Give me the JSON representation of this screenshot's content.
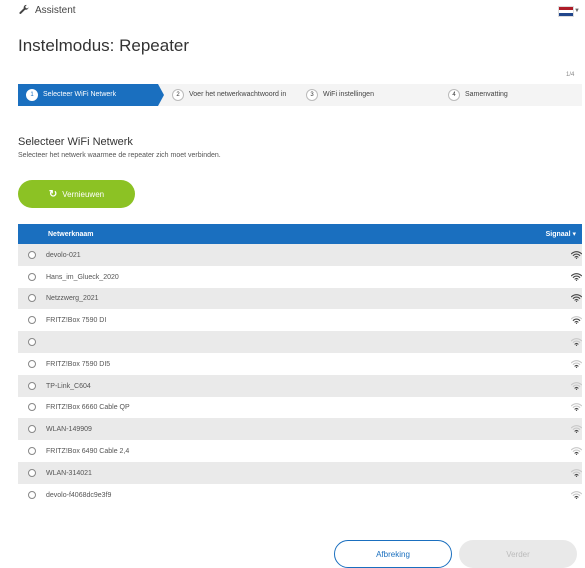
{
  "header": {
    "assistant_label": "Assistent",
    "wrench_icon": "wrench-icon",
    "language_flag": "flag-nl-icon"
  },
  "title": "Instelmodus: Repeater",
  "step_counter": "1/4",
  "steps": [
    {
      "num": "1",
      "label": "Selecteer WiFi Netwerk",
      "active": true
    },
    {
      "num": "2",
      "label": "Voer het netwerkwachtwoord in",
      "active": false
    },
    {
      "num": "3",
      "label": "WiFi instellingen",
      "active": false
    },
    {
      "num": "4",
      "label": "Samenvatting",
      "active": false
    }
  ],
  "section": {
    "title": "Selecteer WiFi Netwerk",
    "subtitle": "Selecteer het netwerk waarmee de repeater zich moet verbinden."
  },
  "refresh_button": {
    "label": "Vernieuwen",
    "icon": "refresh-icon"
  },
  "table": {
    "col_name": "Netwerknaam",
    "col_signal": "Signaal",
    "rows": [
      {
        "name": "devolo-021",
        "signal": 3
      },
      {
        "name": "Hans_im_Glueck_2020",
        "signal": 3
      },
      {
        "name": "Netzzwerg_2021",
        "signal": 3
      },
      {
        "name": "FRITZ!Box 7590 DI",
        "signal": 2
      },
      {
        "name": "",
        "signal": 1
      },
      {
        "name": "FRITZ!Box 7590 DI5",
        "signal": 1
      },
      {
        "name": "TP-Link_C604",
        "signal": 1
      },
      {
        "name": "FRITZ!Box 6660 Cable QP",
        "signal": 1
      },
      {
        "name": "WLAN-149909",
        "signal": 1
      },
      {
        "name": "FRITZ!Box 6490 Cable 2,4",
        "signal": 1
      },
      {
        "name": "WLAN-314021",
        "signal": 1
      },
      {
        "name": "devolo-f4068dc9e3f9",
        "signal": 1
      }
    ]
  },
  "footer": {
    "cancel_label": "Afbreking",
    "next_label": "Verder"
  },
  "colors": {
    "primary": "#1a6fbf",
    "accent_green": "#8cc224",
    "row_alt": "#eaeaea"
  }
}
